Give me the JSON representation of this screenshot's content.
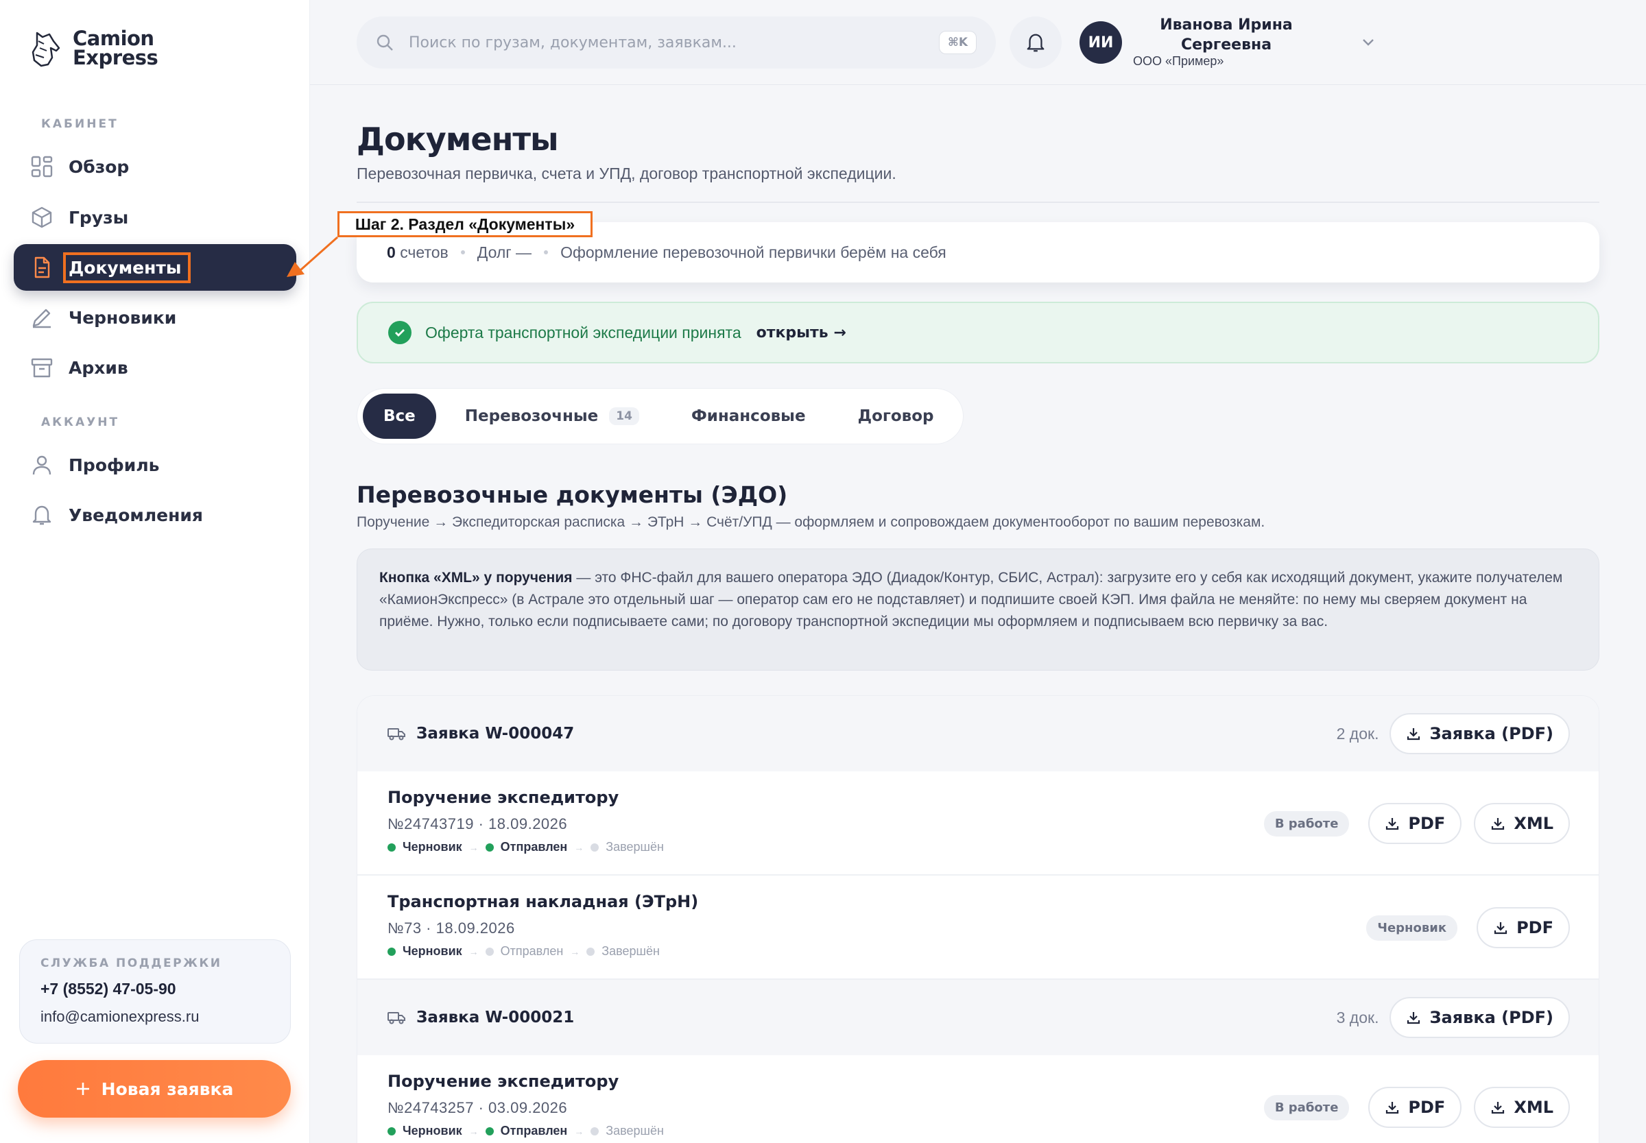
{
  "brand": {
    "line1": "Camion",
    "line2": "Express"
  },
  "sidebar": {
    "section_cabinet": "КАБИНЕТ",
    "section_account": "АККАУНТ",
    "items": [
      {
        "label": "Обзор",
        "icon": "grid-icon"
      },
      {
        "label": "Грузы",
        "icon": "box-icon"
      },
      {
        "label": "Документы",
        "icon": "document-icon",
        "active": true
      },
      {
        "label": "Черновики",
        "icon": "pencil-icon"
      },
      {
        "label": "Архив",
        "icon": "archive-icon"
      },
      {
        "label": "Профиль",
        "icon": "user-icon"
      },
      {
        "label": "Уведомления",
        "icon": "bell-icon"
      }
    ],
    "support": {
      "title": "СЛУЖБА ПОДДЕРЖКИ",
      "phone": "+7 (8552) 47-05-90",
      "email": "info@camionexpress.ru"
    },
    "new_request": "Новая заявка"
  },
  "header": {
    "search_placeholder": "Поиск по грузам, документам, заявкам...",
    "shortcut": "⌘K",
    "avatar_initials": "ИИ",
    "user_name_line1": "Иванова Ирина",
    "user_name_line2": "Сергеевна",
    "user_org": "ООО «Пример»"
  },
  "callout": "Шаг 2. Раздел «Документы»",
  "page": {
    "title": "Документы",
    "subtitle": "Перевозочная первичка, счета и УПД, договор транспортной экспедиции.",
    "summary": {
      "invoices_count": "0",
      "invoices_label": "счетов",
      "debt": "Долг —",
      "note": "Оформление перевозочной первички берём на себя"
    },
    "offer": {
      "text": "Оферта транспортной экспедиции принята",
      "link": "открыть →"
    },
    "tabs": [
      {
        "label": "Все",
        "active": true
      },
      {
        "label": "Перевозочные",
        "count": "14"
      },
      {
        "label": "Финансовые"
      },
      {
        "label": "Договор"
      }
    ],
    "section_title": "Перевозочные документы (ЭДО)",
    "section_sub": "Поручение → Экспедиторская расписка → ЭТрН → Счёт/УПД — оформляем и сопровождаем документооборот по вашим перевозкам.",
    "info_bold": "Кнопка «XML» у поручения",
    "info_text": " — это ФНС-файл для вашего оператора ЭДО (Диадок/Контур, СБИС, Астрал): загрузите его у себя как исходящий документ, укажите получателем «КамионЭкспресс» (в Астрале это отдельный шаг — оператор сам его не подставляет) и подпишите своей КЭП. Имя файла не меняйте: по нему мы сверяем документ на приёме. Нужно, только если подписываете сами; по договору транспортной экспедиции мы оформляем и подписываем всю первичку за вас."
  },
  "groups": [
    {
      "title": "Заявка W-000047",
      "count": "2 док.",
      "button": "Заявка (PDF)",
      "docs": [
        {
          "title": "Поручение экспедитору",
          "meta": "№24743719 · 18.09.2026",
          "status": "В работе",
          "steps": [
            "Черновик",
            "Отправлен",
            "Завершён"
          ],
          "steps_done": 2,
          "buttons": [
            "PDF",
            "XML"
          ]
        },
        {
          "title": "Транспортная накладная (ЭТрН)",
          "meta": "№73 · 18.09.2026",
          "status": "Черновик",
          "steps": [
            "Черновик",
            "Отправлен",
            "Завершён"
          ],
          "steps_done": 1,
          "buttons": [
            "PDF"
          ]
        }
      ]
    },
    {
      "title": "Заявка W-000021",
      "count": "3 док.",
      "button": "Заявка (PDF)",
      "docs": [
        {
          "title": "Поручение экспедитору",
          "meta": "№24743257 · 03.09.2026",
          "status": "В работе",
          "steps": [
            "Черновик",
            "Отправлен",
            "Завершён"
          ],
          "steps_done": 2,
          "buttons": [
            "PDF",
            "XML"
          ]
        }
      ]
    }
  ],
  "colors": {
    "accent": "#f07020",
    "nav_active": "#262c45",
    "success": "#22a05b",
    "cta": "#ff7a3d"
  }
}
